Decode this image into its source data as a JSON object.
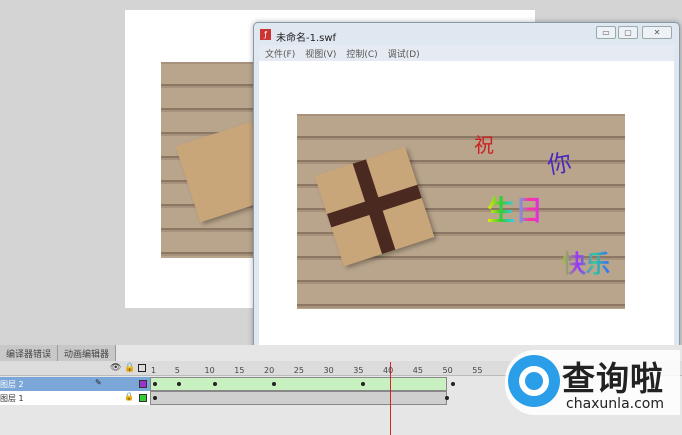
{
  "swf_window": {
    "title": "未命名-1.swf",
    "icon": "flash-player-icon",
    "buttons": {
      "minimize": "minimize-icon",
      "maximize": "maximize-icon",
      "close": "close-icon"
    },
    "menu": [
      "文件(F)",
      "视图(V)",
      "控制(C)",
      "调试(D)"
    ]
  },
  "animation_text": {
    "line1": "祝",
    "line2": "你",
    "line3": "生日",
    "line4": "快乐"
  },
  "panel_tabs": [
    "编译器错误",
    "动画编辑器"
  ],
  "timeline": {
    "ruler": [
      "1",
      "5",
      "10",
      "15",
      "20",
      "25",
      "30",
      "35",
      "40",
      "45",
      "50",
      "55"
    ],
    "current_frame": 41,
    "layers": [
      {
        "name": "图层 2",
        "selected": true,
        "color": "#9933cc",
        "keyframes": [
          1,
          5,
          11,
          21,
          36,
          51
        ]
      },
      {
        "name": "图层 1",
        "selected": false,
        "color": "#33cc33",
        "keyframes": [
          1,
          50
        ]
      }
    ],
    "icons": [
      "eye-icon",
      "lock-icon",
      "outline-icon"
    ]
  },
  "watermark": {
    "brand": "查询啦",
    "url": "chaxunla.com"
  }
}
